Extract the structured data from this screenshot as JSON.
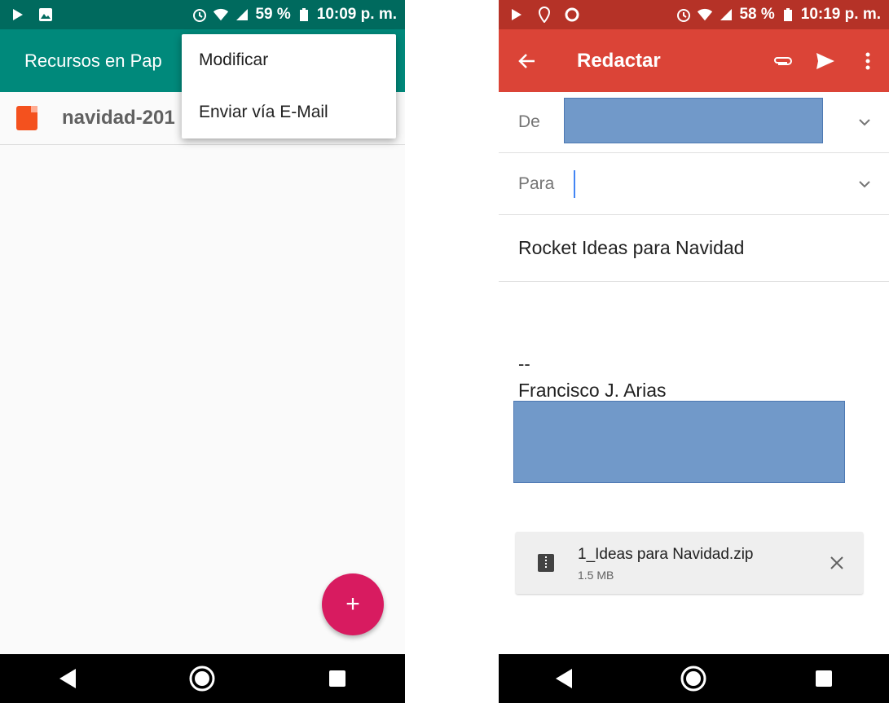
{
  "left": {
    "status": {
      "battery": "59 %",
      "time": "10:09 p. m."
    },
    "appbar": {
      "title": "Recursos en Pap"
    },
    "file": {
      "name": "navidad-201"
    },
    "menu": {
      "items": [
        "Modificar",
        "Enviar vía E-Mail"
      ]
    },
    "fab": {
      "label": "+"
    }
  },
  "right": {
    "status": {
      "battery": "58 %",
      "time": "10:19 p. m."
    },
    "appbar": {
      "title": "Redactar"
    },
    "from": {
      "label": "De"
    },
    "to": {
      "label": "Para"
    },
    "subject": "Rocket Ideas para Navidad",
    "signature": {
      "dash": "--",
      "name": "Francisco J. Arias"
    },
    "attachment": {
      "name": "1_Ideas para Navidad.zip",
      "size": "1.5 MB"
    }
  },
  "colors": {
    "left_status": "#006a5e",
    "left_appbar": "#00897b",
    "right_status": "#b53227",
    "right_appbar": "#db4437",
    "fab": "#d81b60",
    "redaction": "#7199c9"
  },
  "icons": [
    "play-icon",
    "image-icon",
    "alarm-icon",
    "wifi-icon",
    "signal-icon",
    "battery-icon",
    "location-icon",
    "record-icon",
    "back-arrow-icon",
    "paperclip-icon",
    "send-icon",
    "more-vert-icon",
    "chevron-down-icon",
    "zip-file-icon",
    "close-icon",
    "pdf-icon",
    "nav-back-icon",
    "nav-home-icon",
    "nav-recents-icon"
  ]
}
